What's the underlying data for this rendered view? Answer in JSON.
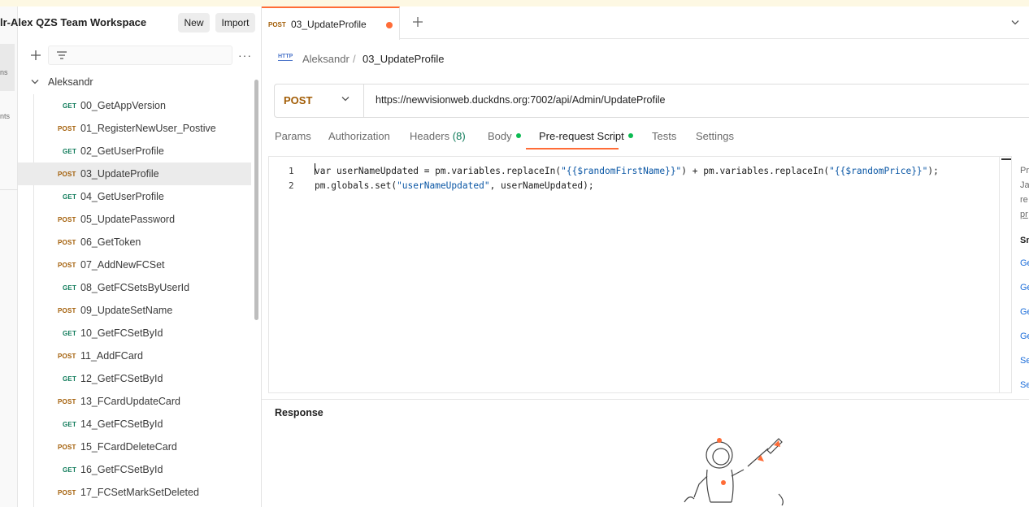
{
  "rail": {
    "item1": "ns",
    "item2": "nts"
  },
  "workspace": {
    "title": "lr-Alex QZS Team Workspace",
    "new_label": "New",
    "import_label": "Import"
  },
  "collection": {
    "name": "Aleksandr",
    "requests": [
      {
        "method": "GET",
        "name": "00_GetAppVersion"
      },
      {
        "method": "POST",
        "name": "01_RegisterNewUser_Postive"
      },
      {
        "method": "GET",
        "name": "02_GetUserProfile"
      },
      {
        "method": "POST",
        "name": "03_UpdateProfile"
      },
      {
        "method": "GET",
        "name": "04_GetUserProfile"
      },
      {
        "method": "POST",
        "name": "05_UpdatePassword"
      },
      {
        "method": "POST",
        "name": "06_GetToken"
      },
      {
        "method": "POST",
        "name": "07_AddNewFCSet"
      },
      {
        "method": "GET",
        "name": "08_GetFCSetsByUserId"
      },
      {
        "method": "POST",
        "name": "09_UpdateSetName"
      },
      {
        "method": "GET",
        "name": "10_GetFCSetById"
      },
      {
        "method": "POST",
        "name": "11_AddFCard"
      },
      {
        "method": "GET",
        "name": "12_GetFCSetById"
      },
      {
        "method": "POST",
        "name": "13_FCardUpdateCard"
      },
      {
        "method": "GET",
        "name": "14_GetFCSetById"
      },
      {
        "method": "POST",
        "name": "15_FCardDeleteCard"
      },
      {
        "method": "GET",
        "name": "16_GetFCSetById"
      },
      {
        "method": "POST",
        "name": "17_FCSetMarkSetDeleted"
      }
    ]
  },
  "tab": {
    "method": "POST",
    "name": "03_UpdateProfile"
  },
  "breadcrumb": {
    "icon": "HTTP",
    "parent": "Aleksandr",
    "separator": "/",
    "current": "03_UpdateProfile"
  },
  "request": {
    "method": "POST",
    "url": "https://newvisionweb.duckdns.org:7002/api/Admin/UpdateProfile"
  },
  "request_tabs": {
    "params": "Params",
    "authorization": "Authorization",
    "headers": "Headers",
    "headers_count": "(8)",
    "body": "Body",
    "prerequest": "Pre-request Script",
    "tests": "Tests",
    "settings": "Settings"
  },
  "editor": {
    "line1_no": "1",
    "line2_no": "2",
    "line1_a": "var userNameUpdated = pm.variables.replaceIn(",
    "line1_s1": "\"{{$randomFirstName}}\"",
    "line1_b": ") + pm.variables.replaceIn(",
    "line1_s2": "\"{{$randomPrice}}\"",
    "line1_c": ");",
    "line2_a": "pm.globals.",
    "line2_kw": "set",
    "line2_b": "(",
    "line2_s": "\"userNameUpdated\"",
    "line2_c": ", userNameUpdated);"
  },
  "side_panel": {
    "t1": "Pre",
    "t2": "Ja",
    "t3": "re",
    "t4": "pr",
    "snippets": "Sn",
    "s1": "Ge",
    "s2": "Ge",
    "s3": "Ge",
    "s4": "Ge",
    "s5": "Se",
    "s6": "Se"
  },
  "response": {
    "title": "Response"
  },
  "colors": {
    "accent": "#ff6c37",
    "get": "#0f7b5a",
    "post": "#a25d06",
    "link": "#1a6cd9",
    "active_dot": "#0cbb52"
  }
}
